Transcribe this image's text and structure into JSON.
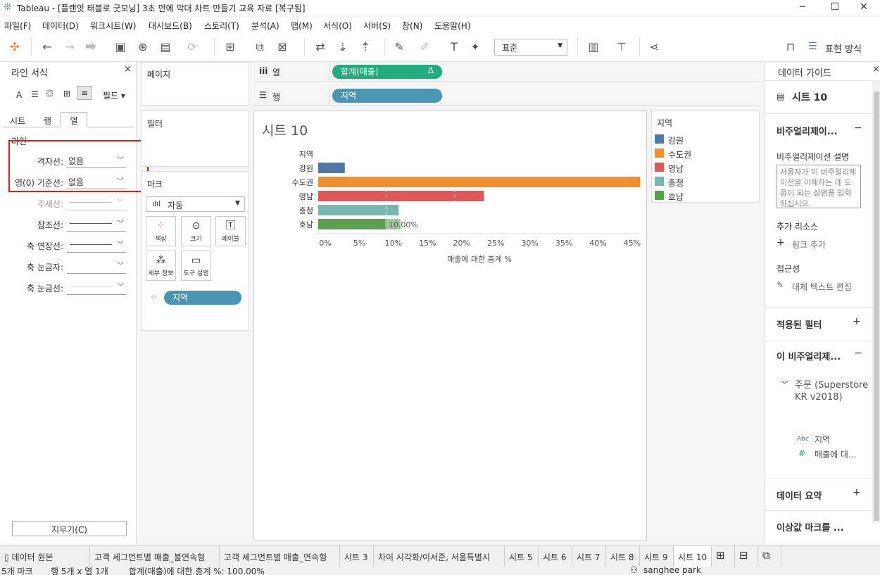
{
  "window": {
    "title": "Tableau - [플랜잇 태블로 굿모닝] 3초 만에 막대 차트 만들기 교육 자료 [복구됨]"
  },
  "menu": [
    "파일(F)",
    "데이터(D)",
    "워크시트(W)",
    "대시보드(B)",
    "스토리(T)",
    "분석(A)",
    "맵(M)",
    "서식(O)",
    "서버(S)",
    "창(N)",
    "도움말(H)"
  ],
  "toolbar": {
    "view_mode": "표준",
    "show_me": "표현 방식"
  },
  "format_pane": {
    "title": "라인 서식",
    "fields_label": "필드",
    "tabs": [
      "시트",
      "행",
      "열"
    ],
    "section": "라인",
    "rows": [
      {
        "label": "격자선:",
        "value": "없음"
      },
      {
        "label": "영(0) 기준선:",
        "value": "없음"
      },
      {
        "label": "추세선:",
        "value": ""
      },
      {
        "label": "참조선:",
        "value": ""
      },
      {
        "label": "축 연장선:",
        "value": ""
      },
      {
        "label": "축 눈금자:",
        "value": ""
      },
      {
        "label": "축 눈금선:",
        "value": ""
      }
    ],
    "clear_button": "지우기(C)"
  },
  "cards": {
    "pages": "페이지",
    "filters": "필터",
    "marks": "마크",
    "mark_type": "자동",
    "mark_buttons": [
      "색상",
      "크기",
      "레이블",
      "세부 정보",
      "도구 설명"
    ],
    "color_field": "지역"
  },
  "shelves": {
    "columns_label": "열",
    "columns_pill": "합계(매출)",
    "columns_delta": "Δ",
    "rows_label": "행",
    "rows_pill": "지역"
  },
  "sheet": {
    "title": "시트 10"
  },
  "chart_data": {
    "type": "bar",
    "title": "시트 10",
    "row_header": "지역",
    "categories": [
      "강원",
      "수도권",
      "영남",
      "충청",
      "호남"
    ],
    "values": [
      3.9,
      47.2,
      24.3,
      11.8,
      10.0
    ],
    "colors": [
      "#4e79a7",
      "#f28e2b",
      "#e15759",
      "#76b7b2",
      "#59a14f"
    ],
    "xlabel": "매출에 대한 총계 %",
    "xticks": [
      "0%",
      "5%",
      "10%",
      "15%",
      "20%",
      "25%",
      "30%",
      "35%",
      "40%",
      "45%"
    ],
    "xlim": [
      0,
      48
    ],
    "data_label": "10.00%",
    "grid": false
  },
  "legend": {
    "title": "지역",
    "items": [
      "강원",
      "수도권",
      "영남",
      "충청",
      "호남"
    ]
  },
  "data_guide": {
    "title": "데이터 가이드",
    "sheet": "시트 10",
    "viz_section": "비주얼리제이...",
    "desc_label": "비주얼리제이션 설명",
    "desc_placeholder": "사용자가 이 비주얼리제이션을 이해하는 데 도움이 되는 설명을 입력하십시오.",
    "resources": "추가 리소스",
    "add_link": "링크 추가",
    "accessibility": "접근성",
    "alt_text": "대체 텍스트 편집",
    "applied_filters": "적용된 필터",
    "this_viz": "이 비주얼리제...",
    "source": "주문 (Superstore KR v2018)",
    "field1": "지역",
    "field2": "매출에 대...",
    "abc": "Abc",
    "hash": "#",
    "summary": "데이터 요약",
    "outliers": "이상값 마크를 ..."
  },
  "tabs": [
    "데이터 원본",
    "고객 세그먼트별 매출_불연속형",
    "고객 세그먼트별 매출_연속형",
    "시트 3",
    "차이 시각화/이서준, 서울특별시",
    "시트 5",
    "시트 6",
    "시트 7",
    "시트 8",
    "시트 9",
    "시트 10"
  ],
  "status": {
    "marks": "5개 마크",
    "rows": "행 5개 x 열 1개",
    "sum": "합계(매출)에 대한 총계 %: 100.00%",
    "user": "sanghee park"
  }
}
